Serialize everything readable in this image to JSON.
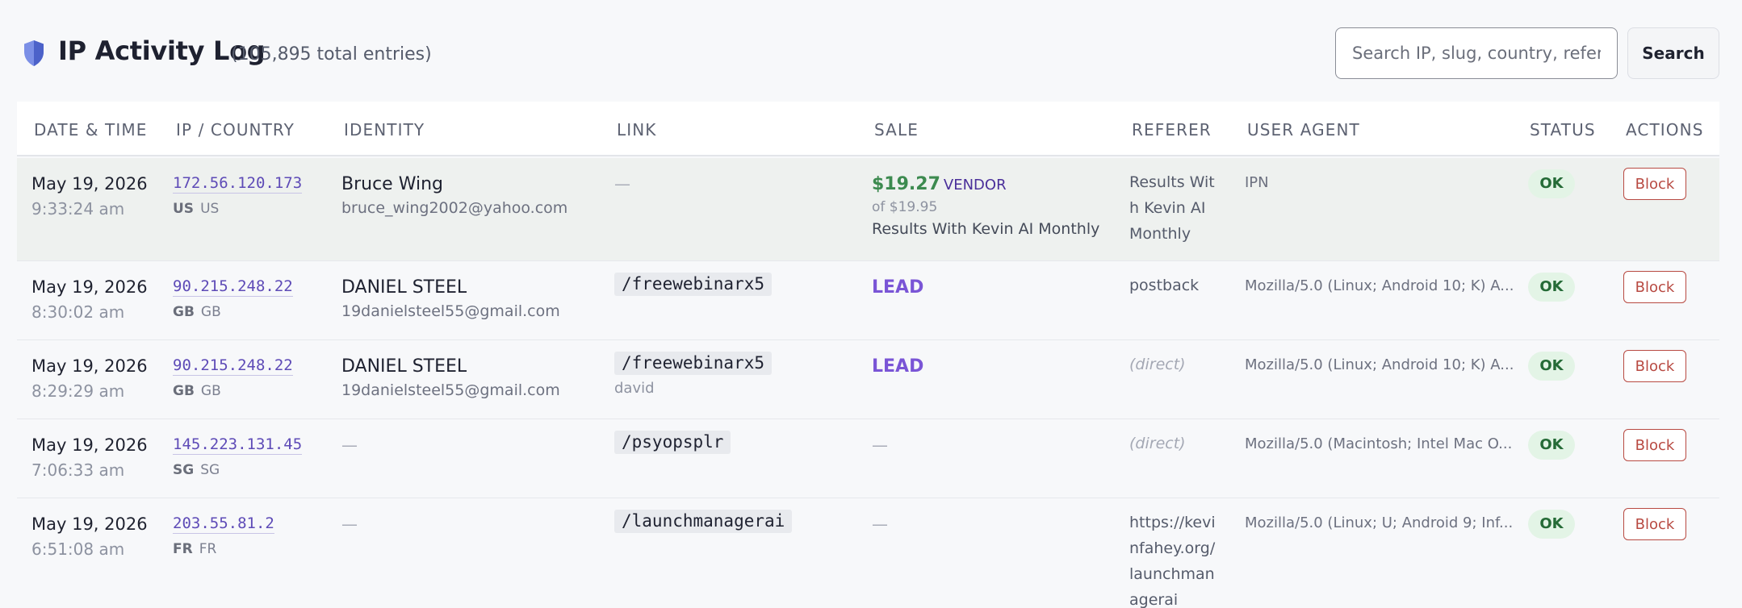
{
  "header": {
    "title": "IP Activity Log",
    "total": "(105,895 total entries)",
    "search_placeholder": "Search IP, slug, country, referer…",
    "search_button": "Search"
  },
  "columns": {
    "datetime": "DATE & TIME",
    "ip_country": "IP / COUNTRY",
    "identity": "IDENTITY",
    "link": "LINK",
    "sale": "SALE",
    "referer": "REFERER",
    "user_agent": "USER AGENT",
    "status": "STATUS",
    "actions": "ACTIONS"
  },
  "rows": [
    {
      "date": "May 19, 2026",
      "time": "9:33:24 am",
      "ip": "172.56.120.173",
      "country_code": "US",
      "country": "US",
      "name": "Bruce Wing",
      "email": "bruce_wing2002@yahoo.com",
      "link": "—",
      "link_sub": "",
      "sale_amount": "$19.27",
      "sale_type": "VENDOR",
      "sale_of": "of $19.95",
      "sale_product": "Results With Kevin AI Monthly",
      "referer": "Results With Kevin AI Monthly",
      "user_agent": "IPN",
      "status": "OK",
      "action": "Block"
    },
    {
      "date": "May 19, 2026",
      "time": "8:30:02 am",
      "ip": "90.215.248.22",
      "country_code": "GB",
      "country": "GB",
      "name": "DANIEL STEEL",
      "email": "19danielsteel55@gmail.com",
      "link": "/freewebinarx5",
      "link_sub": "",
      "sale_label": "LEAD",
      "referer": "postback",
      "user_agent": "Mozilla/5.0 (Linux; Android 10; K) A...",
      "status": "OK",
      "action": "Block"
    },
    {
      "date": "May 19, 2026",
      "time": "8:29:29 am",
      "ip": "90.215.248.22",
      "country_code": "GB",
      "country": "GB",
      "name": "DANIEL STEEL",
      "email": "19danielsteel55@gmail.com",
      "link": "/freewebinarx5",
      "link_sub": "david",
      "sale_label": "LEAD",
      "referer": "(direct)",
      "user_agent": "Mozilla/5.0 (Linux; Android 10; K) A...",
      "status": "OK",
      "action": "Block"
    },
    {
      "date": "May 19, 2026",
      "time": "7:06:33 am",
      "ip": "145.223.131.45",
      "country_code": "SG",
      "country": "SG",
      "identity_empty": "—",
      "link": "/psyopsplr",
      "link_sub": "",
      "sale_empty": "—",
      "referer": "(direct)",
      "user_agent": "Mozilla/5.0 (Macintosh; Intel Mac O...",
      "status": "OK",
      "action": "Block"
    },
    {
      "date": "May 19, 2026",
      "time": "6:51:08 am",
      "ip": "203.55.81.2",
      "country_code": "FR",
      "country": "FR",
      "identity_empty": "—",
      "link": "/launchmanagerai",
      "link_sub": "",
      "sale_empty": "—",
      "referer": "https://kevinfahey.org/launchmanagerai",
      "user_agent": "Mozilla/5.0 (Linux; U; Android 9; Inf...",
      "status": "OK",
      "action": "Block"
    }
  ],
  "colors": {
    "accent": "#5e4bb7",
    "ok_bg": "#e3f4e6",
    "ok_text": "#256b37",
    "block": "#b84a42",
    "sale": "#3c8a4f",
    "lead": "#7a55d6"
  }
}
